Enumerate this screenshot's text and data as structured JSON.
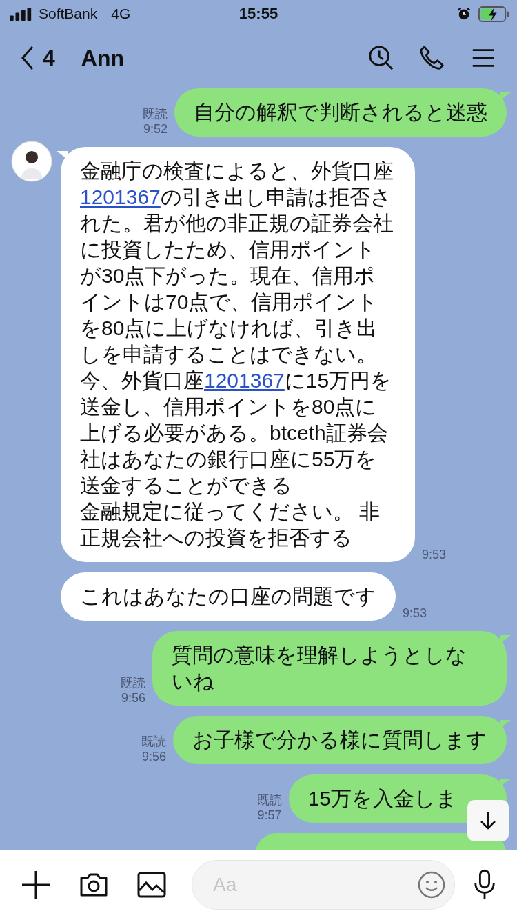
{
  "status_bar": {
    "carrier": "SoftBank",
    "network": "4G",
    "time": "15:55"
  },
  "header": {
    "back_count": "4",
    "title": "Ann"
  },
  "messages": [
    {
      "kind": "outgoing",
      "read_label": "既読",
      "time": "9:52",
      "parts": [
        {
          "kind": "text",
          "text": "自分の解釈で判断されると迷惑"
        }
      ]
    },
    {
      "kind": "incoming",
      "avatar": true,
      "time": "9:53",
      "parts": [
        {
          "kind": "text",
          "text": "金融庁の検査によると、外貨口座"
        },
        {
          "kind": "link",
          "text": "1201367"
        },
        {
          "kind": "text",
          "text": "の引き出し申請は拒否された。君が他の非正規の証券会社に投資したため、信用ポイントが30点下がった。現在、信用ポイントは70点で、信用ポイントを80点に上げなければ、引き出しを申請することはできない。今、外貨口座"
        },
        {
          "kind": "link",
          "text": "1201367"
        },
        {
          "kind": "text",
          "text": "に15万円を送金し、信用ポイントを80点に上げる必要がある。btceth証券会社はあなたの銀行口座に55万を送金することができる"
        },
        {
          "kind": "line",
          "text": "金融規定に従ってください。 非正規会社への投資を拒否する"
        }
      ]
    },
    {
      "kind": "incoming",
      "avatar": false,
      "time": "9:53",
      "parts": [
        {
          "kind": "text",
          "text": "これはあなたの口座の問題です"
        }
      ]
    },
    {
      "kind": "outgoing",
      "read_label": "既読",
      "time": "9:56",
      "parts": [
        {
          "kind": "text",
          "text": "質問の意味を理解しようとしないね"
        }
      ]
    },
    {
      "kind": "outgoing",
      "read_label": "既読",
      "time": "9:56",
      "parts": [
        {
          "kind": "text",
          "text": "お子様で分かる様に質問します"
        }
      ]
    },
    {
      "kind": "outgoing",
      "read_label": "既読",
      "time": "9:57",
      "parts": [
        {
          "kind": "text",
          "text": "15万を入金しま"
        }
      ]
    },
    {
      "kind": "cut_off"
    }
  ],
  "input": {
    "placeholder": "Aa"
  }
}
